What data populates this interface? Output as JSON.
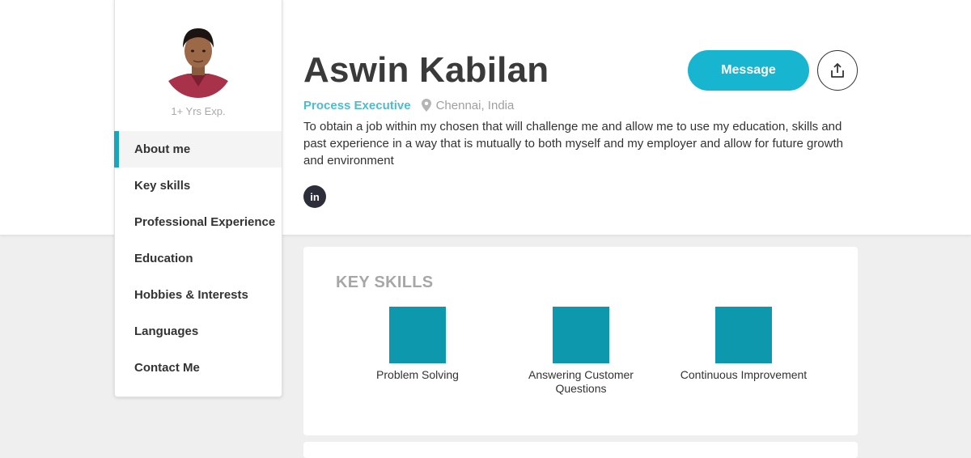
{
  "profile": {
    "name": "Aswin Kabilan",
    "role": "Process Executive",
    "location": "Chennai, India",
    "experience": "1+ Yrs Exp.",
    "bio": "To obtain a job within my chosen that will challenge me and allow me to use my education, skills and past experience in a way that is mutually to both myself and my employer and allow for future growth and environment",
    "social": {
      "linkedin_label": "in"
    }
  },
  "actions": {
    "message_label": "Message",
    "share_icon": "share-icon"
  },
  "nav": {
    "items": [
      {
        "label": "About me",
        "active": true
      },
      {
        "label": "Key skills"
      },
      {
        "label": "Professional Experience"
      },
      {
        "label": "Education"
      },
      {
        "label": "Hobbies & Interests"
      },
      {
        "label": "Languages"
      },
      {
        "label": "Contact Me"
      }
    ]
  },
  "skills": {
    "title": "KEY SKILLS",
    "items": [
      {
        "label": "Problem Solving"
      },
      {
        "label": "Answering Customer Questions"
      },
      {
        "label": "Continuous Improvement"
      }
    ]
  },
  "colors": {
    "accent": "#17b5cf",
    "skill_square": "#0e98ae",
    "role_text": "#4fbccc"
  }
}
